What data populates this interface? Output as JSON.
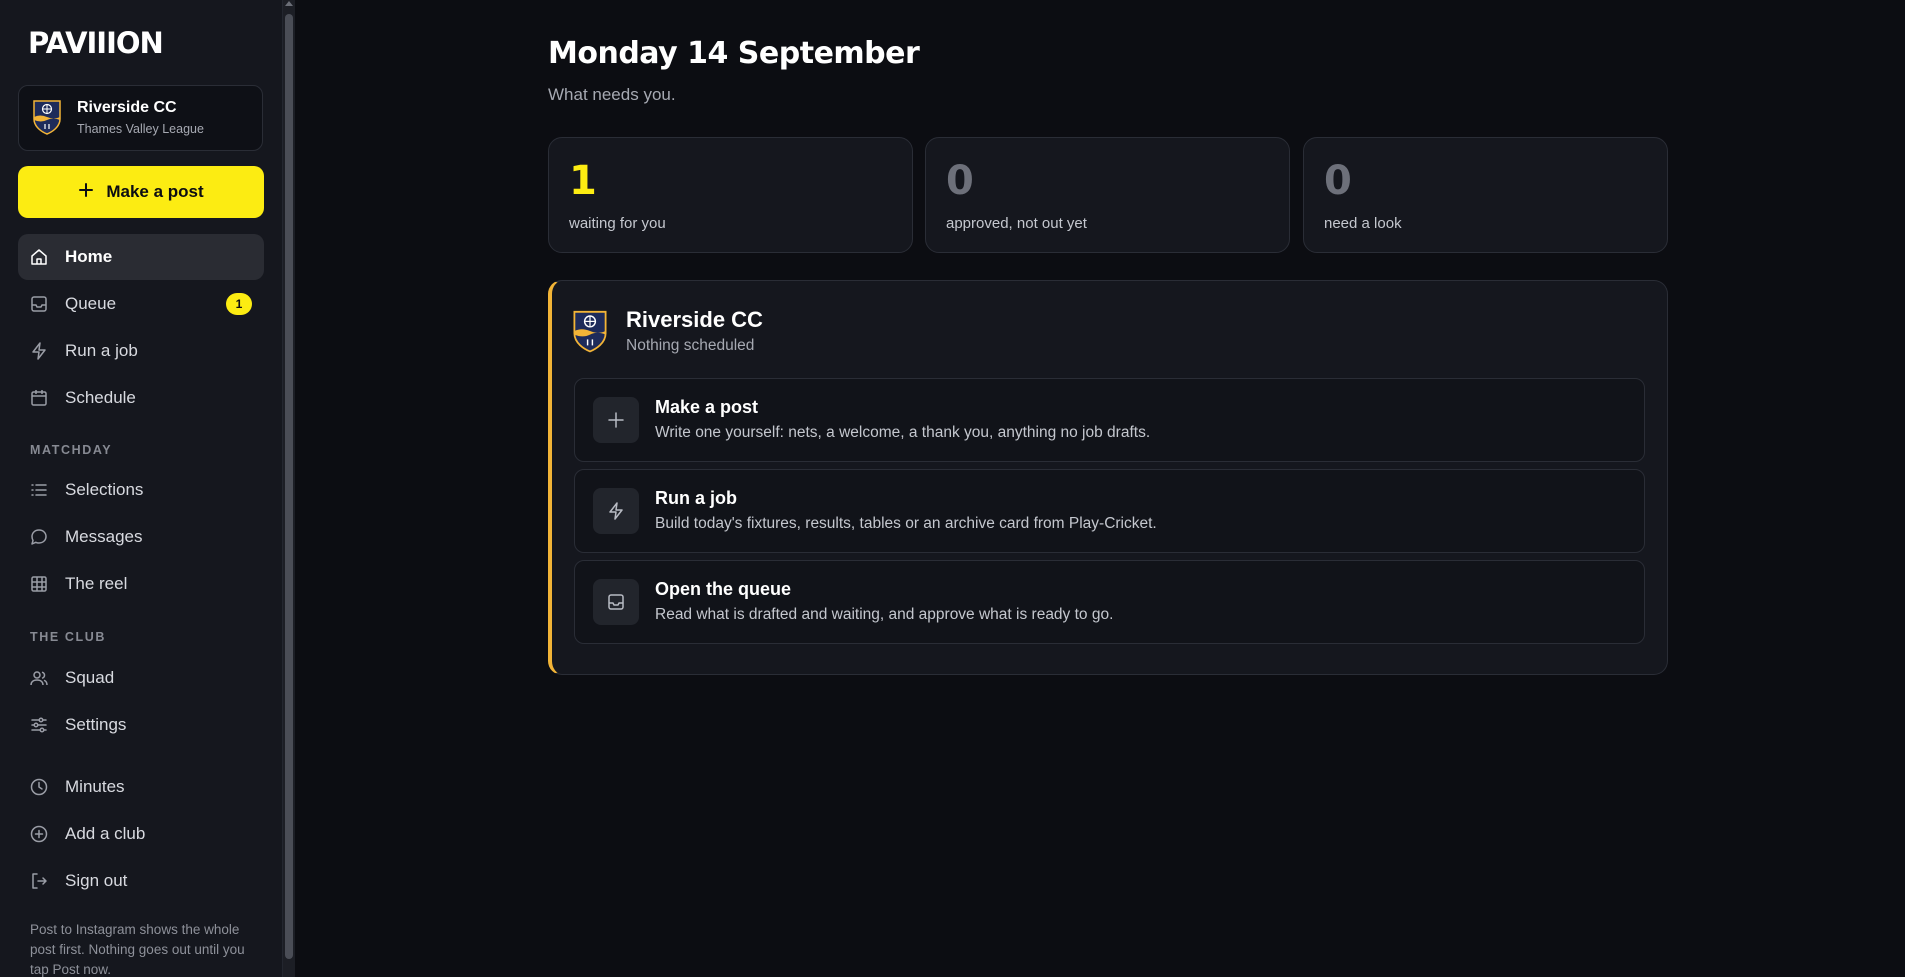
{
  "app": {
    "brand": "PAVIIION"
  },
  "club_card": {
    "name": "Riverside CC",
    "league": "Thames Valley League"
  },
  "make_post_button": {
    "label": "Make a post",
    "icon": "plus-icon"
  },
  "nav": {
    "home": {
      "label": "Home",
      "icon": "home-icon"
    },
    "queue": {
      "label": "Queue",
      "icon": "inbox-icon",
      "badge": "1"
    },
    "run_job": {
      "label": "Run a job",
      "icon": "lightning-icon"
    },
    "schedule": {
      "label": "Schedule",
      "icon": "calendar-icon"
    },
    "matchday_label": "MATCHDAY",
    "selections": {
      "label": "Selections",
      "icon": "list-icon"
    },
    "messages": {
      "label": "Messages",
      "icon": "chat-bubble-icon"
    },
    "reel": {
      "label": "The reel",
      "icon": "grid-icon"
    },
    "club_label": "THE CLUB",
    "squad": {
      "label": "Squad",
      "icon": "users-icon"
    },
    "settings": {
      "label": "Settings",
      "icon": "sliders-icon"
    },
    "minutes": {
      "label": "Minutes",
      "icon": "clock-icon"
    },
    "add_club": {
      "label": "Add a club",
      "icon": "plus-circle-icon"
    },
    "sign_out": {
      "label": "Sign out",
      "icon": "sign-out-icon"
    }
  },
  "footer_note": "Post to Instagram shows the whole post first. Nothing goes out until you tap Post now.",
  "main": {
    "title": "Monday 14 September",
    "subtitle": "What needs you.",
    "stats": [
      {
        "value": "1",
        "label": "waiting for you"
      },
      {
        "value": "0",
        "label": "approved, not out yet"
      },
      {
        "value": "0",
        "label": "need a look"
      }
    ],
    "club_panel": {
      "name": "Riverside CC",
      "status": "Nothing scheduled",
      "actions": [
        {
          "title": "Make a post",
          "description": "Write one yourself: nets, a welcome, a thank you, anything no job drafts.",
          "icon": "plus-icon"
        },
        {
          "title": "Run a job",
          "description": "Build today's fixtures, results, tables or an archive card from Play-Cricket.",
          "icon": "lightning-icon"
        },
        {
          "title": "Open the queue",
          "description": "Read what is drafted and waiting, and approve what is ready to go.",
          "icon": "inbox-icon"
        }
      ]
    }
  },
  "colors": {
    "background": "#0c0d12",
    "sidebar": "#15171e",
    "accent_yellow": "#fcec12",
    "accent_gold": "#f2b437",
    "card_border": "#2a2d36"
  }
}
